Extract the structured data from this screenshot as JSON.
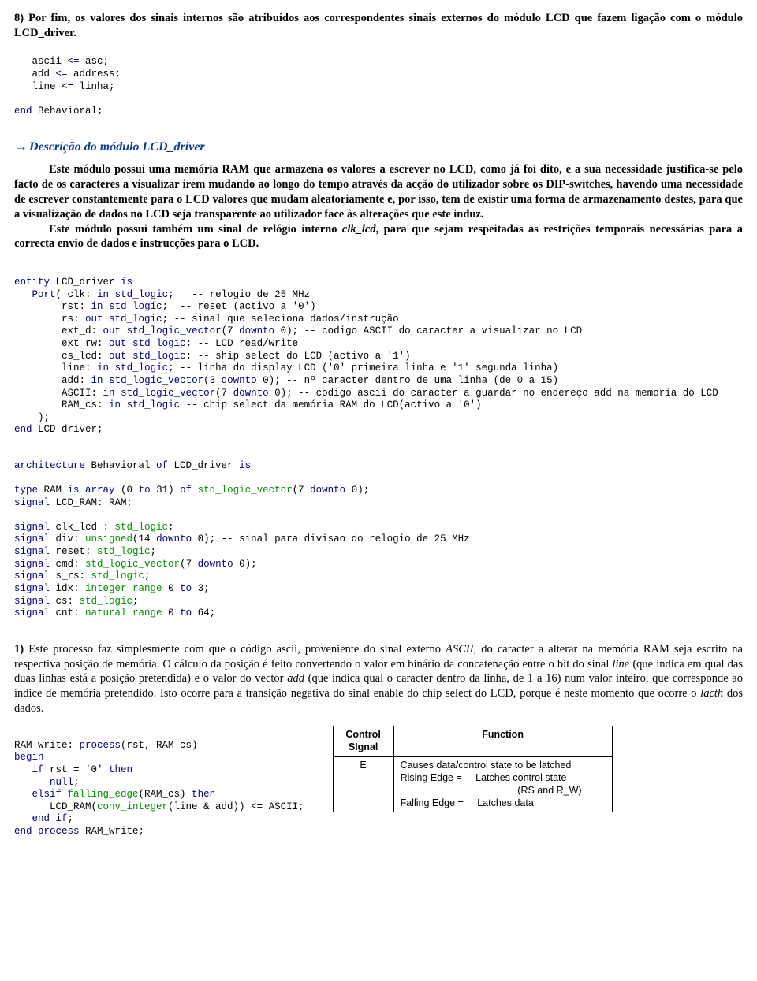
{
  "intro8": "8) Por fim, os valores dos sinais internos são atribuídos aos correspondentes sinais externos do módulo LCD que fazem ligação com o módulo LCD_driver.",
  "code1": {
    "l1a": "   ascii ",
    "l1b": "<=",
    "l1c": " asc;",
    "l2a": "   add ",
    "l2b": "<=",
    "l2c": " address;",
    "l3a": "   line ",
    "l3b": "<=",
    "l3c": " linha;",
    "l5a": "end",
    "l5b": " Behavioral;"
  },
  "heading": "Descrição do módulo LCD_driver",
  "desc_p1_a": "Este módulo possui uma memória RAM que armazena os valores a escrever no LCD, como já foi dito, e a sua necessidade justifica-se pelo facto de os caracteres a visualizar irem mudando ao longo do tempo através da acção do utilizador sobre os DIP-switches, havendo uma necessidade de escrever constantemente para o LCD valores que mudam aleatoriamente e, por isso, tem de existir uma forma de armazenamento destes, para que a visualização de dados no LCD seja transparente ao utilizador face às alterações que este induz.",
  "desc_p2_a": "Este módulo possui também um sinal de relógio interno ",
  "desc_p2_b": "clk_lcd",
  "desc_p2_c": ", para que sejam respeitadas as restrições temporais necessárias para a correcta envio de dados e instrucções para o LCD.",
  "entity": {
    "l1a": "entity",
    "l1b": " LCD_driver ",
    "l1c": "is",
    "l2a": "   Port",
    "l2b": "( clk: ",
    "l2c": "in",
    "l2d": " ",
    "l2e": "std_logic",
    "l2f": ";   -- relogio de 25 MHz",
    "l3a": "        rst: ",
    "l3b": "in",
    "l3c": " ",
    "l3d": "std_logic",
    "l3e": ";  -- reset (activo a '0')",
    "l4a": "        rs: ",
    "l4b": "out",
    "l4c": " ",
    "l4d": "std_logic",
    "l4e": "; -- sinal que seleciona dados/instrução",
    "l5a": "        ext_d: ",
    "l5b": "out",
    "l5c": " ",
    "l5d": "std_logic_vector",
    "l5e": "(7 ",
    "l5f": "downto",
    "l5g": " 0); -- codigo ASCII do caracter a visualizar no LCD",
    "l6a": "        ext_rw: ",
    "l6b": "out",
    "l6c": " ",
    "l6d": "std_logic",
    "l6e": "; -- LCD read/write",
    "l7a": "        cs_lcd: ",
    "l7b": "out",
    "l7c": " ",
    "l7d": "std_logic",
    "l7e": "; -- ship select do LCD (activo a '1')",
    "l8a": "        line: ",
    "l8b": "in",
    "l8c": " ",
    "l8d": "std_logic",
    "l8e": "; -- linha do display LCD ('0' primeira linha e '1' segunda linha)",
    "l9a": "        add: ",
    "l9b": "in",
    "l9c": " ",
    "l9d": "std_logic_vector",
    "l9e": "(3 ",
    "l9f": "downto",
    "l9g": " 0); -- nº caracter dentro de uma linha (de 0 a 15)",
    "l10a": "        ASCII: ",
    "l10b": "in",
    "l10c": " ",
    "l10d": "std_logic_vector",
    "l10e": "(7 ",
    "l10f": "downto",
    "l10g": " 0); -- codigo ascii do caracter a guardar no endereço add na memoria do LCD",
    "l11a": "        RAM_cs: ",
    "l11b": "in",
    "l11c": " ",
    "l11d": "std_logic",
    "l11e": " -- chip select da memória RAM do LCD(activo a '0')",
    "l12": "    );",
    "l13a": "end",
    "l13b": " LCD_driver;"
  },
  "arch": {
    "l1a": "architecture",
    "l1b": " Behavioral ",
    "l1c": "of",
    "l1d": " LCD_driver ",
    "l1e": "is",
    "l3a": "type",
    "l3b": " RAM ",
    "l3c": "is array",
    "l3d": " (0 ",
    "l3e": "to",
    "l3f": " 31) ",
    "l3g": "of",
    "l3h": " ",
    "l3i": "std_logic_vector",
    "l3j": "(7 ",
    "l3k": "downto",
    "l3l": " 0);",
    "l4a": "signal",
    "l4b": " LCD_RAM: RAM;",
    "l6a": "signal",
    "l6b": " clk_lcd : ",
    "l6c": "std_logic",
    "l6d": ";",
    "l7a": "signal",
    "l7b": " div: ",
    "l7c": "unsigned",
    "l7d": "(14 ",
    "l7e": "downto",
    "l7f": " 0); -- sinal para divisao do relogio de 25 MHz",
    "l8a": "signal",
    "l8b": " reset: ",
    "l8c": "std_logic",
    "l8d": ";",
    "l9a": "signal",
    "l9b": " cmd: ",
    "l9c": "std_logic_vector",
    "l9d": "(7 ",
    "l9e": "downto",
    "l9f": " 0);",
    "l10a": "signal",
    "l10b": " s_rs: ",
    "l10c": "std_logic",
    "l10d": ";",
    "l11a": "signal",
    "l11b": " idx: ",
    "l11c": "integer range",
    "l11d": " 0 ",
    "l11e": "to",
    "l11f": " 3;",
    "l12a": "signal",
    "l12b": " cs: ",
    "l12c": "std_logic",
    "l12d": ";",
    "l13a": "signal",
    "l13b": " cnt: ",
    "l13c": "natural range",
    "l13d": " 0 ",
    "l13e": "to",
    "l13f": " 64;"
  },
  "p1_a": "1)",
  "p1_b": " Este processo faz simplesmente com que o código ascii, proveniente do sinal externo ",
  "p1_c": "ASCII,",
  "p1_d": " do caracter a alterar na memória RAM seja escrito na respectiva posição de memória. O cálculo da posição é feito convertendo o valor em binário da concatenação entre o bit do sinal ",
  "p1_e": "line",
  "p1_f": " (que indica em qual das duas linhas está a posição pretendida) e o valor do vector ",
  "p1_g": "add",
  "p1_h": " (que indica qual o caracter dentro da linha, de 1 a 16) num valor inteiro, que corresponde ao índice de memória pretendido. Isto ocorre para a transição negativa do sinal enable do chip select do LCD, porque é neste momento que ocorre o ",
  "p1_i": "lacth",
  "p1_j": " dos dados.",
  "proc": {
    "l1a": "RAM_write: ",
    "l1b": "process",
    "l1c": "(rst, RAM_cs)",
    "l2a": "begin",
    "l3a": "   if",
    "l3b": " rst = '0' ",
    "l3c": "then",
    "l4a": "      null",
    "l4b": ";",
    "l5a": "   elsif",
    "l5b": " ",
    "l5c": "falling_edge",
    "l5d": "(RAM_cs) ",
    "l5e": "then",
    "l6a": "      LCD_RAM(",
    "l6b": "conv_integer",
    "l6c": "(line & add)) <= ASCII;",
    "l7a": "   end if",
    "l7b": ";",
    "l8a": "end process",
    "l8b": " RAM_write;"
  },
  "table": {
    "h1": "Control SIgnal",
    "h2": "Function",
    "c1": "E",
    "r1": "Causes data/control state to be latched",
    "r2a": "Rising Edge =",
    "r2b": "Latches control state",
    "r2c": "(RS and R_W)",
    "r3a": "Falling Edge =",
    "r3b": "Latches data"
  }
}
